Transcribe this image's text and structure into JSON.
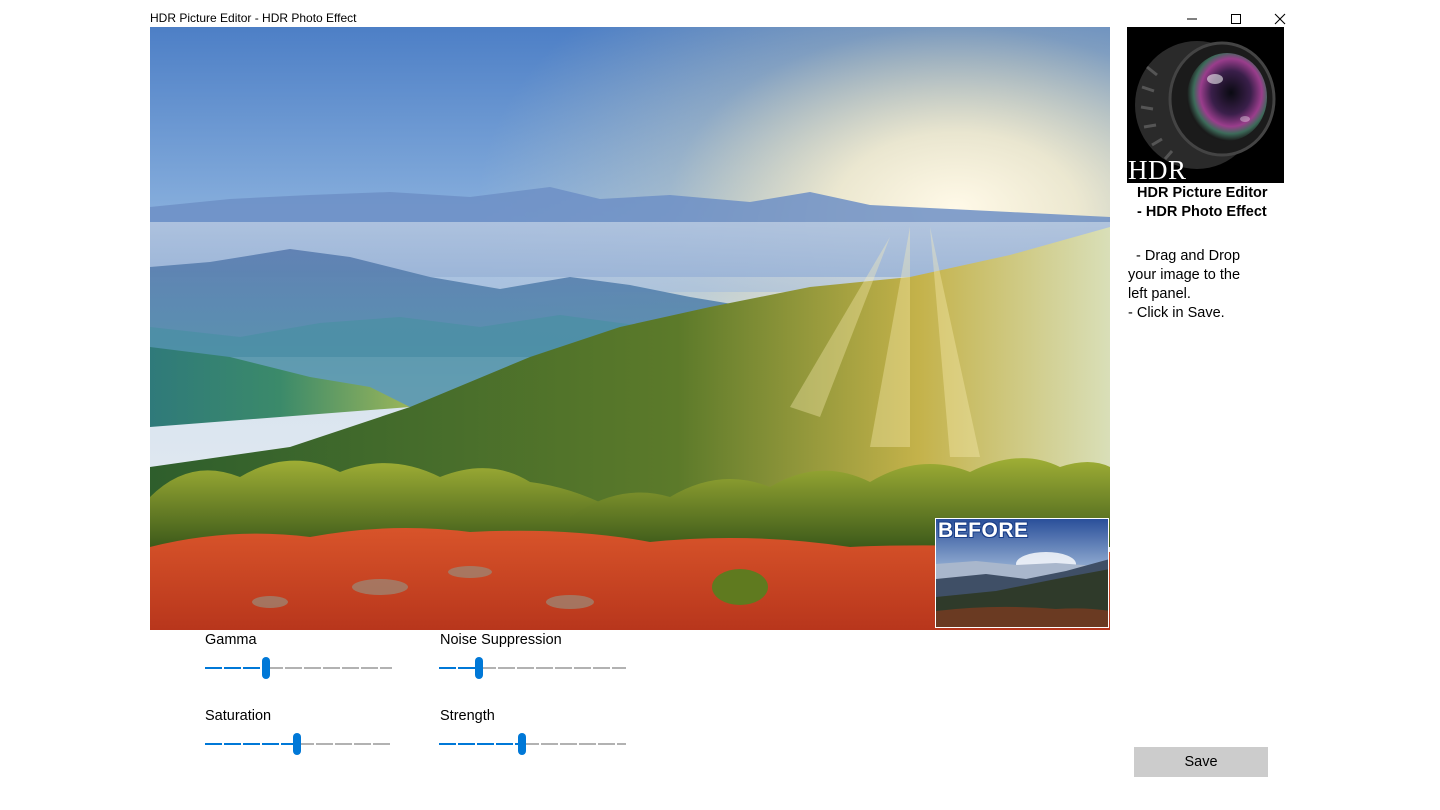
{
  "window": {
    "title": "HDR Picture Editor - HDR Photo Effect",
    "controls": [
      "minimize-icon",
      "maximize-icon",
      "close-icon"
    ]
  },
  "preview": {
    "before_label": "BEFORE"
  },
  "sidebar": {
    "logo_text": "HDR",
    "heading": " HDR Picture Editor\n - HDR Photo Effect",
    "instructions": "  - Drag and Drop\nyour image to the\nleft panel.\n- Click in Save."
  },
  "sliders": [
    {
      "label": "Gamma",
      "value": 0.32
    },
    {
      "label": "Noise Suppression",
      "value": 0.2
    },
    {
      "label": "Saturation",
      "value": 0.49
    },
    {
      "label": "Strength",
      "value": 0.44
    }
  ],
  "actions": {
    "save_label": "Save"
  },
  "colors": {
    "accent": "#0078d7",
    "track_inactive": "#999999",
    "save_button_bg": "#cccccc"
  }
}
